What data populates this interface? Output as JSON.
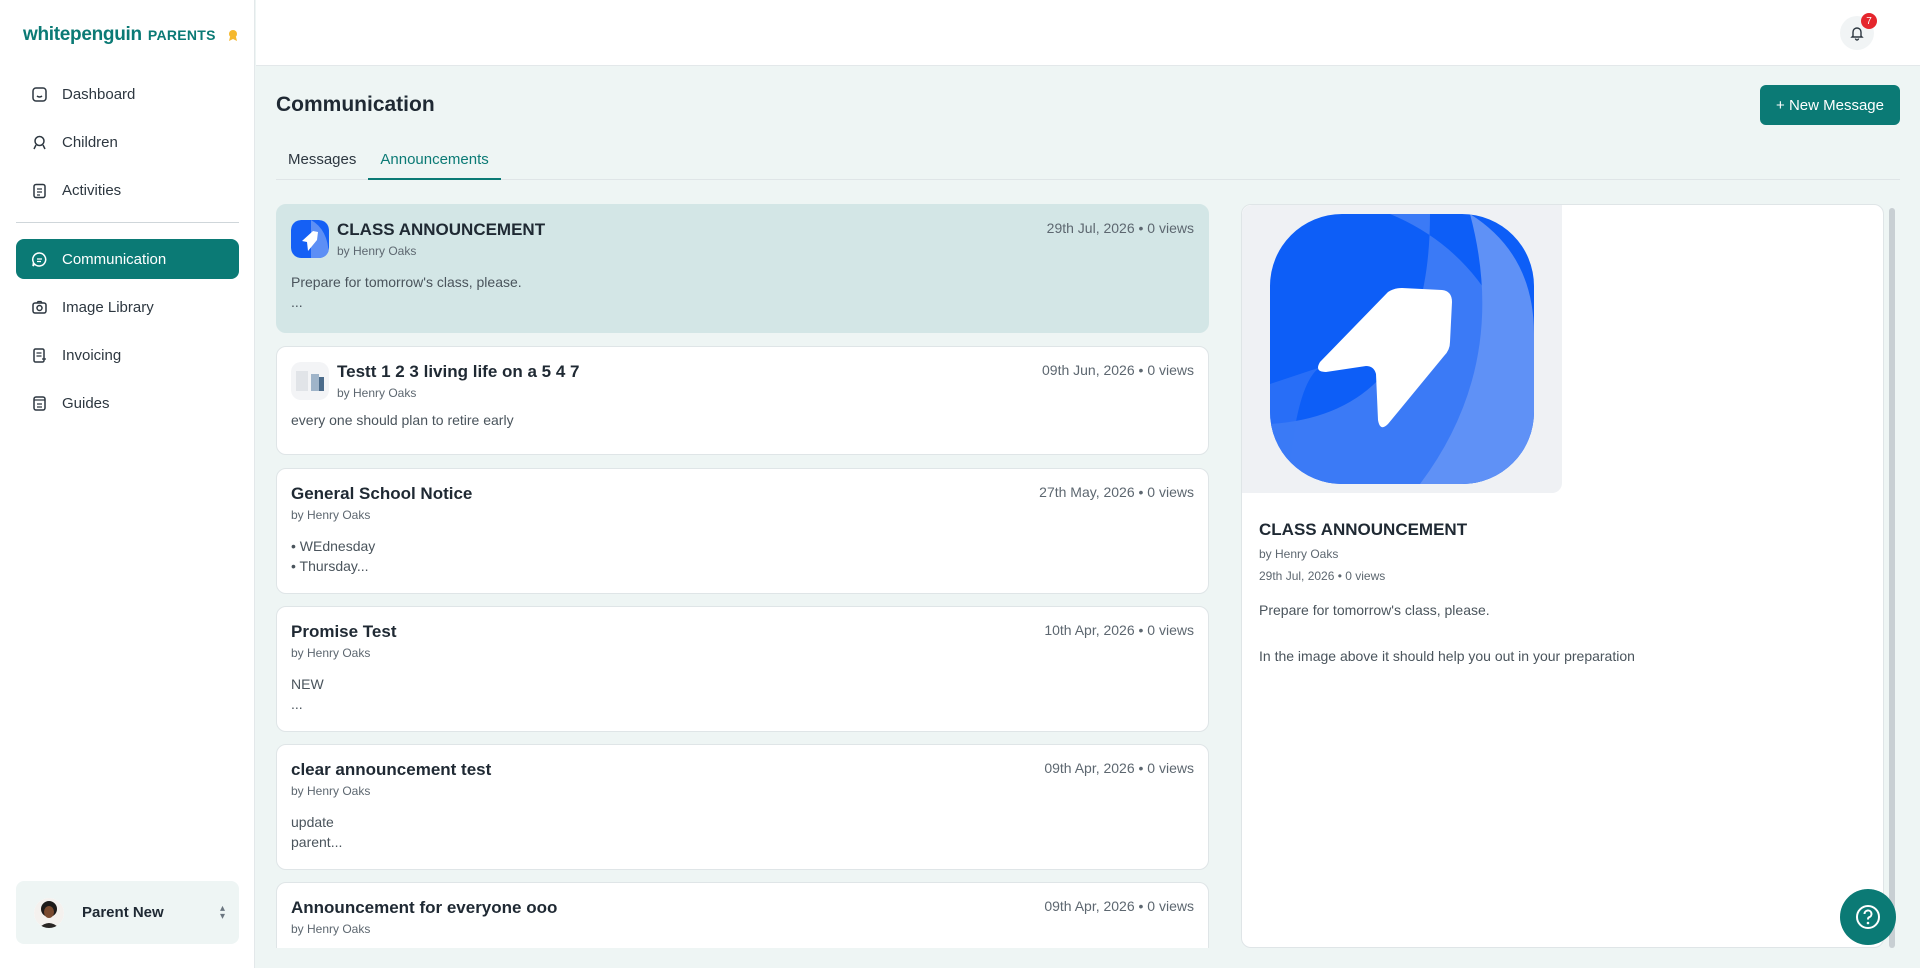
{
  "app": {
    "brand": "whitepenguin",
    "brand_sub": "PARENTS",
    "accent": "#0b7a75"
  },
  "sidebar": {
    "items": [
      {
        "label": "Dashboard",
        "icon": "home-icon"
      },
      {
        "label": "Children",
        "icon": "child-icon"
      },
      {
        "label": "Activities",
        "icon": "clipboard-icon"
      },
      {
        "label": "Communication",
        "icon": "chat-icon",
        "active": true
      },
      {
        "label": "Image Library",
        "icon": "camera-icon"
      },
      {
        "label": "Invoicing",
        "icon": "invoice-icon"
      },
      {
        "label": "Guides",
        "icon": "book-icon"
      }
    ],
    "user": {
      "name": "Parent New"
    }
  },
  "header": {
    "notification_count": "7"
  },
  "main": {
    "title": "Communication",
    "new_message_label": "+ New Message",
    "tabs": [
      {
        "label": "Messages"
      },
      {
        "label": "Announcements",
        "active": true
      }
    ],
    "announcements": [
      {
        "title": "CLASS ANNOUNCEMENT",
        "by": "by Henry Oaks",
        "meta": "29th Jul, 2026  •  0 views",
        "body": "Prepare for tomorrow's class, please.\n...",
        "selected": true,
        "thumb": "app-logo"
      },
      {
        "title": "Testt 1 2 3 living life on a 5 4 7",
        "by": "by Henry Oaks",
        "meta": "09th Jun, 2026  •  0 views",
        "body": "every one should plan to retire early",
        "thumb": "document"
      },
      {
        "title": "General School Notice",
        "by": "by Henry Oaks",
        "meta": "27th May, 2026  •  0 views",
        "body": "• WEdnesday\n• Thursday..."
      },
      {
        "title": "Promise Test",
        "by": "by Henry Oaks",
        "meta": "10th Apr, 2026  •  0 views",
        "body": "NEW\n..."
      },
      {
        "title": "clear announcement test",
        "by": "by Henry Oaks",
        "meta": "09th Apr, 2026  •  0 views",
        "body": "update\nparent..."
      },
      {
        "title": "Announcement for everyone ooo",
        "by": "by Henry Oaks",
        "meta": "09th Apr, 2026  •  0 views",
        "body": ""
      }
    ],
    "detail": {
      "title": "CLASS ANNOUNCEMENT",
      "by": "by Henry Oaks",
      "meta": "29th Jul, 2026  •  0 views",
      "body": "Prepare for tomorrow's class, please.\n\nIn the image above it should help you out in your preparation"
    }
  }
}
